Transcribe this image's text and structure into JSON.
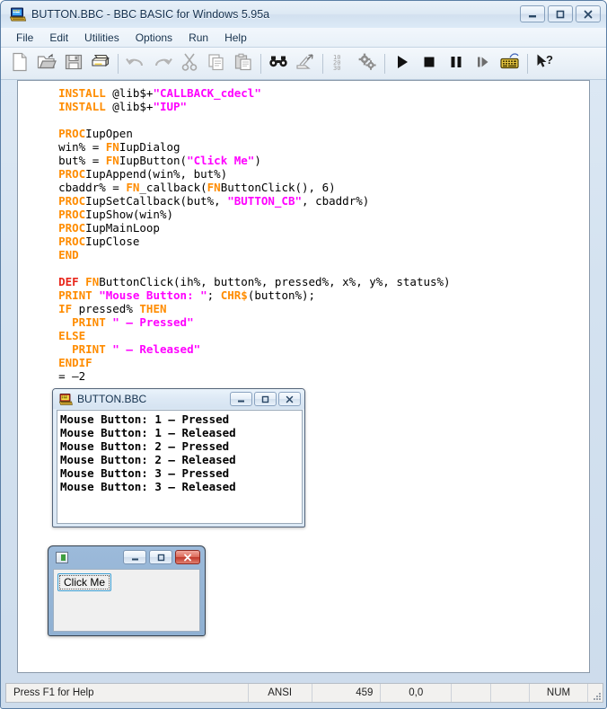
{
  "window": {
    "title": "BUTTON.BBC - BBC BASIC for Windows 5.95a",
    "icon": "bbc-basic-app-icon",
    "buttons": {
      "minimize": "–",
      "maximize": "□",
      "close": "✕"
    }
  },
  "menu": {
    "items": [
      "File",
      "Edit",
      "Utilities",
      "Options",
      "Run",
      "Help"
    ]
  },
  "toolbar": {
    "buttons": [
      {
        "name": "new-icon",
        "tip": "New"
      },
      {
        "name": "open-icon",
        "tip": "Open"
      },
      {
        "name": "save-icon",
        "tip": "Save"
      },
      {
        "name": "print-icon",
        "tip": "Print"
      },
      {
        "name": "undo-icon",
        "tip": "Undo"
      },
      {
        "name": "redo-icon",
        "tip": "Redo"
      },
      {
        "name": "cut-icon",
        "tip": "Cut"
      },
      {
        "name": "copy-icon",
        "tip": "Copy"
      },
      {
        "name": "paste-icon",
        "tip": "Paste"
      },
      {
        "name": "find-icon",
        "tip": "Find"
      },
      {
        "name": "replace-icon",
        "tip": "Replace"
      },
      {
        "name": "line-numbers-icon",
        "tip": "Renumber"
      },
      {
        "name": "settings-gears-icon",
        "tip": "Compile"
      },
      {
        "name": "run-icon",
        "tip": "Run"
      },
      {
        "name": "stop-icon",
        "tip": "Stop"
      },
      {
        "name": "pause-icon",
        "tip": "Pause"
      },
      {
        "name": "step-icon",
        "tip": "Single Step"
      },
      {
        "name": "keyboard-icon",
        "tip": "Immediate Mode"
      },
      {
        "name": "context-help-icon",
        "tip": "Context Help"
      }
    ]
  },
  "editor": {
    "lines": [
      {
        "indent": 2,
        "tokens": [
          {
            "t": "kw",
            "v": "INSTALL"
          },
          {
            "t": "pl",
            "v": " @lib$+"
          },
          {
            "t": "str",
            "v": "\"CALLBACK_cdecl\""
          }
        ]
      },
      {
        "indent": 2,
        "tokens": [
          {
            "t": "kw",
            "v": "INSTALL"
          },
          {
            "t": "pl",
            "v": " @lib$+"
          },
          {
            "t": "str",
            "v": "\"IUP\""
          }
        ]
      },
      {
        "indent": 0,
        "tokens": []
      },
      {
        "indent": 2,
        "tokens": [
          {
            "t": "kw",
            "v": "PROC"
          },
          {
            "t": "pl",
            "v": "IupOpen"
          }
        ]
      },
      {
        "indent": 2,
        "tokens": [
          {
            "t": "pl",
            "v": "win% = "
          },
          {
            "t": "kw",
            "v": "FN"
          },
          {
            "t": "pl",
            "v": "IupDialog"
          }
        ]
      },
      {
        "indent": 2,
        "tokens": [
          {
            "t": "pl",
            "v": "but% = "
          },
          {
            "t": "kw",
            "v": "FN"
          },
          {
            "t": "pl",
            "v": "IupButton("
          },
          {
            "t": "str",
            "v": "\"Click Me\""
          },
          {
            "t": "pl",
            "v": ")"
          }
        ]
      },
      {
        "indent": 2,
        "tokens": [
          {
            "t": "kw",
            "v": "PROC"
          },
          {
            "t": "pl",
            "v": "IupAppend(win%, but%)"
          }
        ]
      },
      {
        "indent": 2,
        "tokens": [
          {
            "t": "pl",
            "v": "cbaddr% = "
          },
          {
            "t": "kw",
            "v": "FN"
          },
          {
            "t": "pl",
            "v": "_callback("
          },
          {
            "t": "kw",
            "v": "FN"
          },
          {
            "t": "pl",
            "v": "ButtonClick(), 6)"
          }
        ]
      },
      {
        "indent": 2,
        "tokens": [
          {
            "t": "kw",
            "v": "PROC"
          },
          {
            "t": "pl",
            "v": "IupSetCallback(but%, "
          },
          {
            "t": "str",
            "v": "\"BUTTON_CB\""
          },
          {
            "t": "pl",
            "v": ", cbaddr%)"
          }
        ]
      },
      {
        "indent": 2,
        "tokens": [
          {
            "t": "kw",
            "v": "PROC"
          },
          {
            "t": "pl",
            "v": "IupShow(win%)"
          }
        ]
      },
      {
        "indent": 2,
        "tokens": [
          {
            "t": "kw",
            "v": "PROC"
          },
          {
            "t": "pl",
            "v": "IupMainLoop"
          }
        ]
      },
      {
        "indent": 2,
        "tokens": [
          {
            "t": "kw",
            "v": "PROC"
          },
          {
            "t": "pl",
            "v": "IupClose"
          }
        ]
      },
      {
        "indent": 2,
        "tokens": [
          {
            "t": "kw",
            "v": "END"
          }
        ]
      },
      {
        "indent": 0,
        "tokens": []
      },
      {
        "indent": 2,
        "tokens": [
          {
            "t": "kwr",
            "v": "DEF"
          },
          {
            "t": "pl",
            "v": " "
          },
          {
            "t": "kw",
            "v": "FN"
          },
          {
            "t": "pl",
            "v": "ButtonClick(ih%, button%, pressed%, x%, y%, status%)"
          }
        ]
      },
      {
        "indent": 2,
        "tokens": [
          {
            "t": "kw",
            "v": "PRINT"
          },
          {
            "t": "pl",
            "v": " "
          },
          {
            "t": "str",
            "v": "\"Mouse Button: \""
          },
          {
            "t": "pl",
            "v": "; "
          },
          {
            "t": "kw",
            "v": "CHR$"
          },
          {
            "t": "pl",
            "v": "(button%);"
          }
        ]
      },
      {
        "indent": 2,
        "tokens": [
          {
            "t": "kw",
            "v": "IF"
          },
          {
            "t": "pl",
            "v": " pressed% "
          },
          {
            "t": "kw",
            "v": "THEN"
          }
        ]
      },
      {
        "indent": 4,
        "tokens": [
          {
            "t": "kw",
            "v": "PRINT"
          },
          {
            "t": "pl",
            "v": " "
          },
          {
            "t": "str",
            "v": "\" – Pressed\""
          }
        ]
      },
      {
        "indent": 2,
        "tokens": [
          {
            "t": "kw",
            "v": "ELSE"
          }
        ]
      },
      {
        "indent": 4,
        "tokens": [
          {
            "t": "kw",
            "v": "PRINT"
          },
          {
            "t": "pl",
            "v": " "
          },
          {
            "t": "str",
            "v": "\" – Released\""
          }
        ]
      },
      {
        "indent": 2,
        "tokens": [
          {
            "t": "kw",
            "v": "ENDIF"
          }
        ]
      },
      {
        "indent": 2,
        "tokens": [
          {
            "t": "pl",
            "v": "= –2"
          }
        ]
      }
    ],
    "colors": {
      "keyword": "#ff8c00",
      "def_keyword": "#e8261b",
      "string": "#ff00ff",
      "plain": "#000000",
      "background": "#ffffff"
    }
  },
  "output_window": {
    "title": "BUTTON.BBC",
    "icon": "bbc-basic-output-icon",
    "buttons": {
      "minimize": "–",
      "maximize": "□",
      "close": "✕"
    },
    "text": "Mouse Button: 1 – Pressed\nMouse Button: 1 – Released\nMouse Button: 2 – Pressed\nMouse Button: 2 – Released\nMouse Button: 3 – Pressed\nMouse Button: 3 – Released"
  },
  "iup_dialog": {
    "title": "",
    "icon": "iup-window-icon",
    "buttons": {
      "minimize": "–",
      "maximize": "□",
      "close": "✕"
    },
    "button_label": "Click Me",
    "close_color": "#c0392b"
  },
  "statusbar": {
    "hint": "Press F1 for Help",
    "encoding": "ANSI",
    "line": "459",
    "position": "0,0",
    "cell4": "",
    "cell5": "",
    "numlock": "NUM",
    "cell7": ""
  }
}
